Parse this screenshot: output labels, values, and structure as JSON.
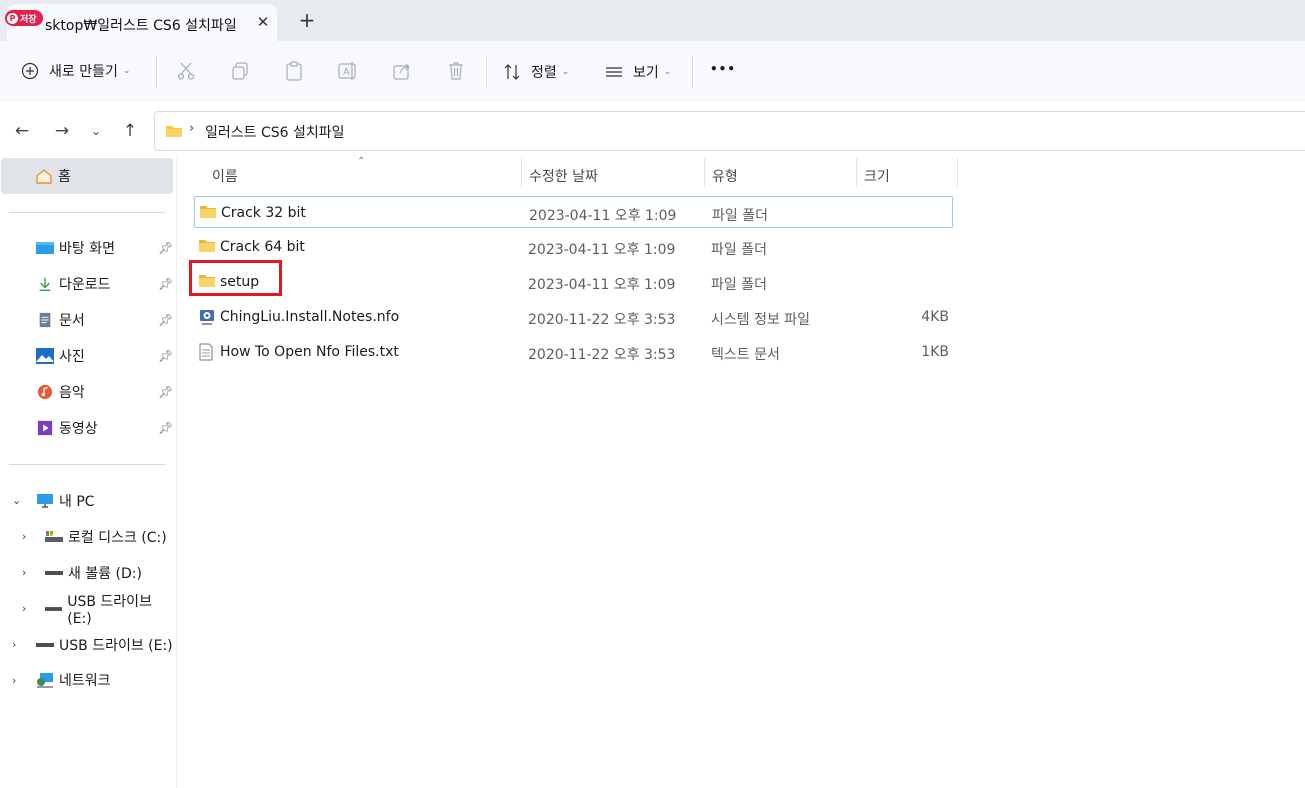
{
  "tab": {
    "badge": "저장",
    "title": "sktop₩일러스트 CS6 설치파일"
  },
  "toolbar": {
    "new_label": "새로 만들기",
    "sort_label": "정렬",
    "view_label": "보기",
    "more_label": "•••"
  },
  "address": {
    "separator": "›",
    "path": "일러스트 CS6 설치파일"
  },
  "nav": {
    "home": "홈",
    "quick": [
      {
        "label": "바탕 화면",
        "icon": "desktop-icon"
      },
      {
        "label": "다운로드",
        "icon": "download-icon"
      },
      {
        "label": "문서",
        "icon": "document-icon"
      },
      {
        "label": "사진",
        "icon": "pictures-icon"
      },
      {
        "label": "음악",
        "icon": "music-icon"
      },
      {
        "label": "동영상",
        "icon": "video-icon"
      }
    ],
    "this_pc": "내 PC",
    "drives": [
      {
        "label": "로컬 디스크 (C:)"
      },
      {
        "label": "새 볼륨 (D:)"
      },
      {
        "label": "USB 드라이브 (E:)"
      }
    ],
    "usb": "USB 드라이브 (E:)",
    "network": "네트워크"
  },
  "columns": {
    "name": "이름",
    "date": "수정한 날짜",
    "type": "유형",
    "size": "크기"
  },
  "files": [
    {
      "name": "Crack 32 bit",
      "date": "2023-04-11 오후 1:09",
      "type": "파일 폴더",
      "size": "",
      "icon": "folder-icon"
    },
    {
      "name": "Crack 64 bit",
      "date": "2023-04-11 오후 1:09",
      "type": "파일 폴더",
      "size": "",
      "icon": "folder-icon"
    },
    {
      "name": "setup",
      "date": "2023-04-11 오후 1:09",
      "type": "파일 폴더",
      "size": "",
      "icon": "folder-icon"
    },
    {
      "name": "ChingLiu.Install.Notes.nfo",
      "date": "2020-11-22 오후 3:53",
      "type": "시스템 정보 파일",
      "size": "4KB",
      "icon": "system-info-file-icon"
    },
    {
      "name": "How To Open Nfo Files.txt",
      "date": "2020-11-22 오후 3:53",
      "type": "텍스트 문서",
      "size": "1KB",
      "icon": "text-file-icon"
    }
  ],
  "colors": {
    "tabbar_bg": "#e8ecf1",
    "toolbar_bg": "#f7f9fc",
    "highlight": "#e0181f",
    "folder": "#f5c542",
    "badge": "#e6204b"
  }
}
